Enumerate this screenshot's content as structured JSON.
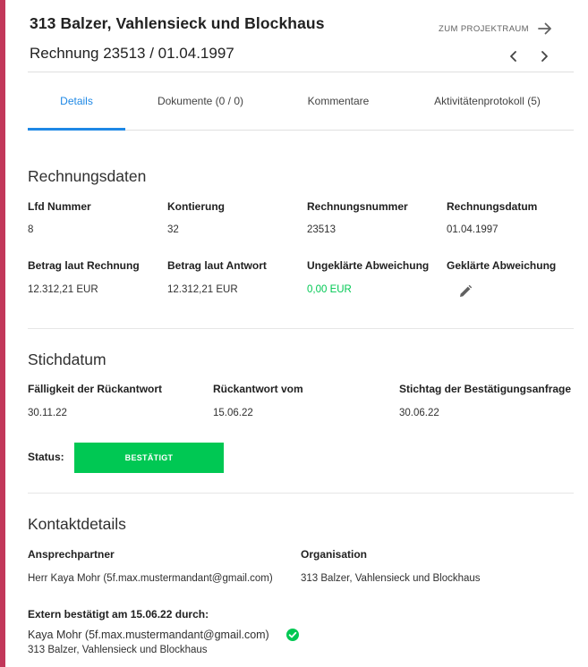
{
  "header": {
    "project_title": "313 Balzer, Vahlensieck und Blockhaus",
    "invoice_title": "Rechnung 23513 / 01.04.1997",
    "projektraum_label": "ZUM PROJEKTRAUM"
  },
  "tabs": [
    {
      "label": "Details",
      "active": true
    },
    {
      "label": "Dokumente (0 / 0)",
      "active": false
    },
    {
      "label": "Kommentare",
      "active": false
    },
    {
      "label": "Aktivitätenprotokoll (5)",
      "active": false
    }
  ],
  "rechnungsdaten": {
    "title": "Rechnungsdaten",
    "fields": [
      {
        "label": "Lfd Nummer",
        "value": "8"
      },
      {
        "label": "Kontierung",
        "value": "32"
      },
      {
        "label": "Rechnungsnummer",
        "value": "23513"
      },
      {
        "label": "Rechnungsdatum",
        "value": "01.04.1997"
      },
      {
        "label": "Betrag laut Rechnung",
        "value": "12.312,21 EUR"
      },
      {
        "label": "Betrag laut Antwort",
        "value": "12.312,21 EUR"
      },
      {
        "label": "Ungeklärte Abweichung",
        "value": "0,00 EUR"
      },
      {
        "label": "Geklärte Abweichung",
        "value": ""
      }
    ]
  },
  "stichdatum": {
    "title": "Stichdatum",
    "fields": [
      {
        "label": "Fälligkeit der Rückantwort",
        "value": "30.11.22"
      },
      {
        "label": "Rückantwort vom",
        "value": "15.06.22"
      },
      {
        "label": "Stichtag der Bestätigungsanfrage",
        "value": "30.06.22"
      }
    ],
    "status_label": "Status:",
    "status_value": "BESTÄTIGT"
  },
  "kontakt": {
    "title": "Kontaktdetails",
    "ansprechpartner_label": "Ansprechpartner",
    "ansprechpartner_value": "Herr Kaya Mohr (5f.max.mustermandant@gmail.com)",
    "organisation_label": "Organisation",
    "organisation_value": "313 Balzer, Vahlensieck und Blockhaus",
    "extern_label": "Extern bestätigt am 15.06.22 durch:",
    "extern_person": "Kaya Mohr (5f.max.mustermandant@gmail.com)",
    "extern_org": "313 Balzer, Vahlensieck und Blockhaus"
  },
  "colors": {
    "accent_bar": "#c2375a",
    "active_tab": "#1e88e5",
    "success": "#00c853"
  }
}
